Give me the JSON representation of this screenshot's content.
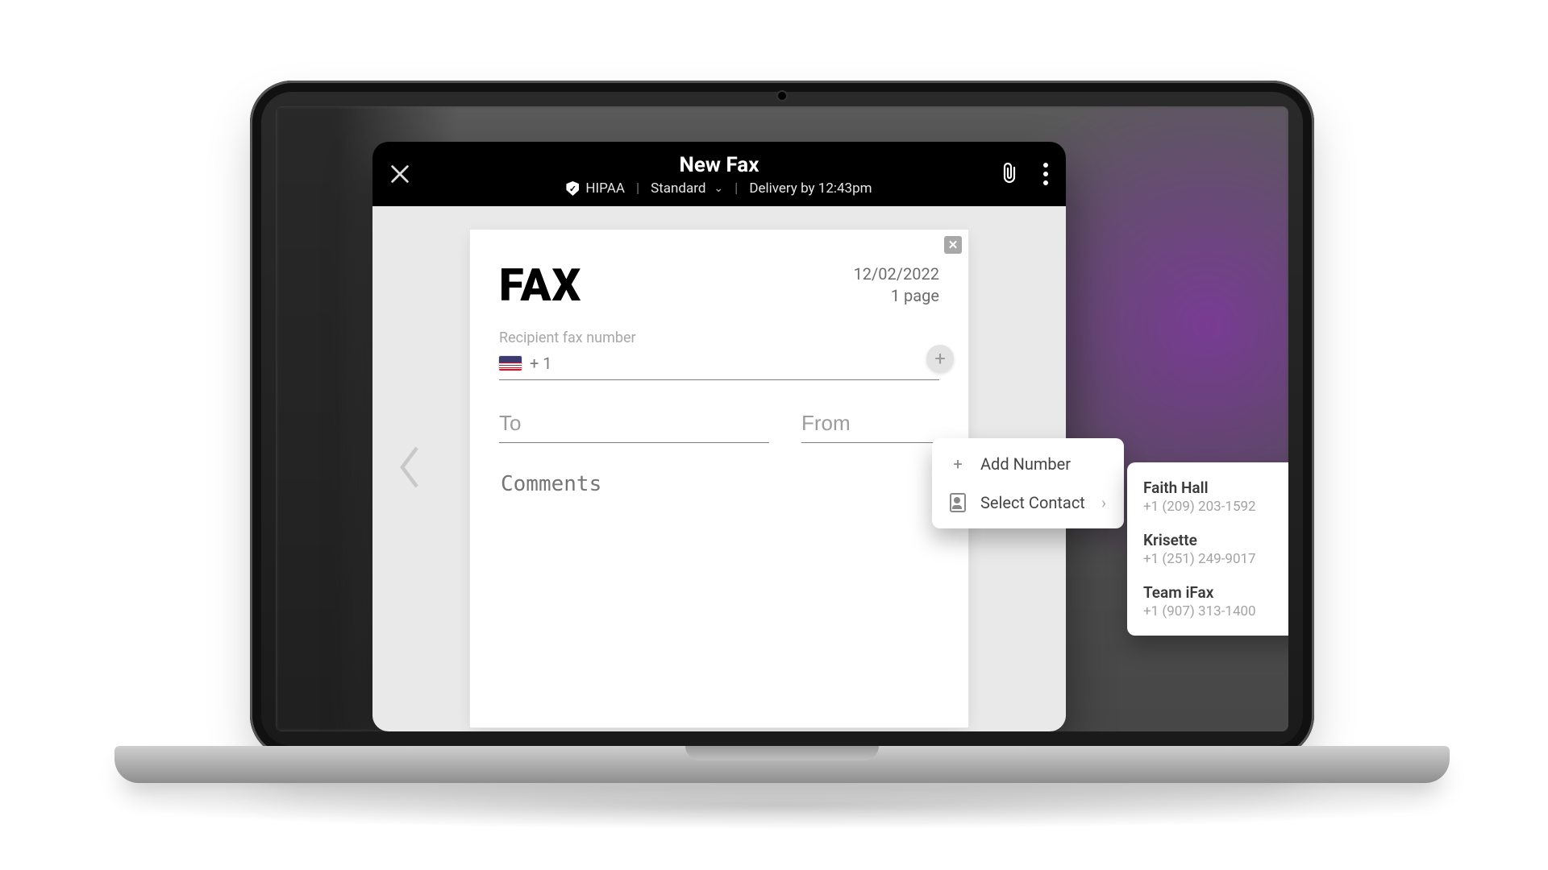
{
  "modal": {
    "title": "New Fax",
    "hipaa_label": "HIPAA",
    "priority_label": "Standard",
    "delivery_label": "Delivery by 12:43pm"
  },
  "cover": {
    "heading": "FAX",
    "date": "12/02/2022",
    "pages": "1 page",
    "recipient_label": "Recipient fax number",
    "country_code": "+ 1",
    "to_placeholder": "To",
    "from_placeholder": "From",
    "comments_placeholder": "Comments"
  },
  "add_menu": {
    "add_number": "Add Number",
    "select_contact": "Select Contact"
  },
  "contacts": [
    {
      "name": "Faith Hall",
      "phone": "+1 (209) 203-1592"
    },
    {
      "name": "Krisette",
      "phone": "+1 (251) 249-9017"
    },
    {
      "name": "Team iFax",
      "phone": "+1 (907) 313-1400"
    }
  ],
  "icons": {
    "close": "close-icon",
    "attach": "paperclip-icon",
    "more": "more-vertical-icon",
    "shield": "shield-check-icon",
    "chevron_down": "chevron-down-icon",
    "chevron_right": "chevron-right-icon",
    "plus": "plus-icon",
    "nav_left": "chevron-left-icon",
    "nav_right": "chevron-right-icon",
    "contact": "contact-card-icon",
    "flag": "flag-us-icon"
  }
}
